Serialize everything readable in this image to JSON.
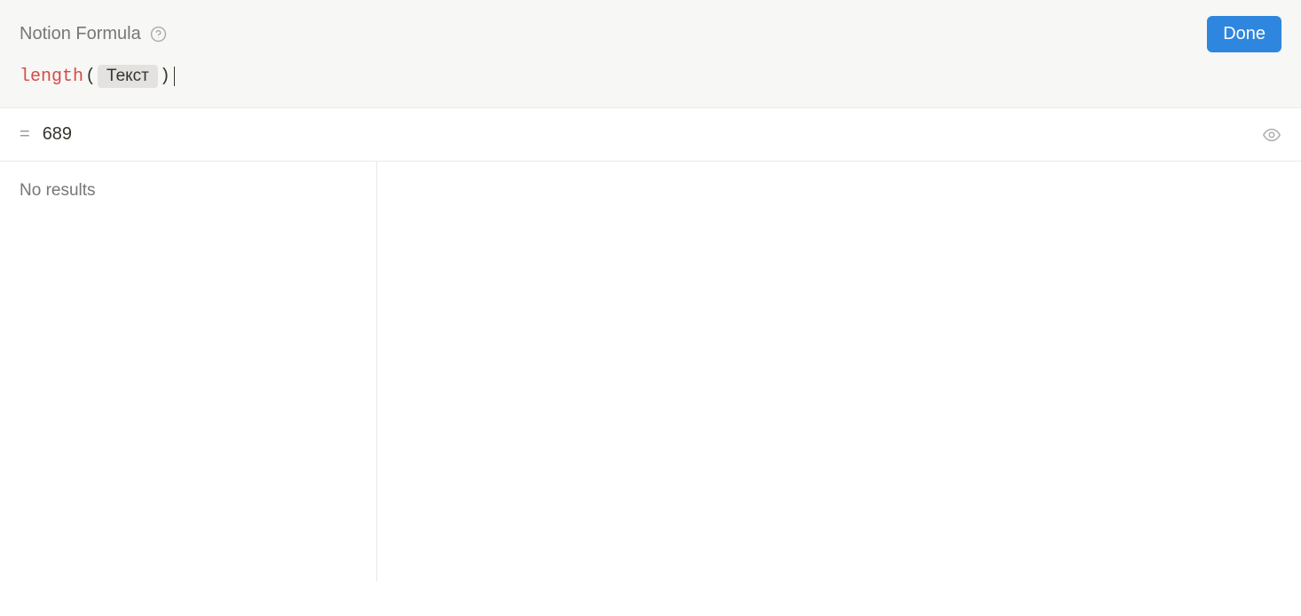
{
  "header": {
    "title": "Notion Formula",
    "done_label": "Done"
  },
  "formula": {
    "function": "length",
    "open_paren": "(",
    "property_token": "Текст",
    "close_paren": ")"
  },
  "result": {
    "equals": "=",
    "value": "689"
  },
  "left_pane": {
    "no_results": "No results"
  }
}
